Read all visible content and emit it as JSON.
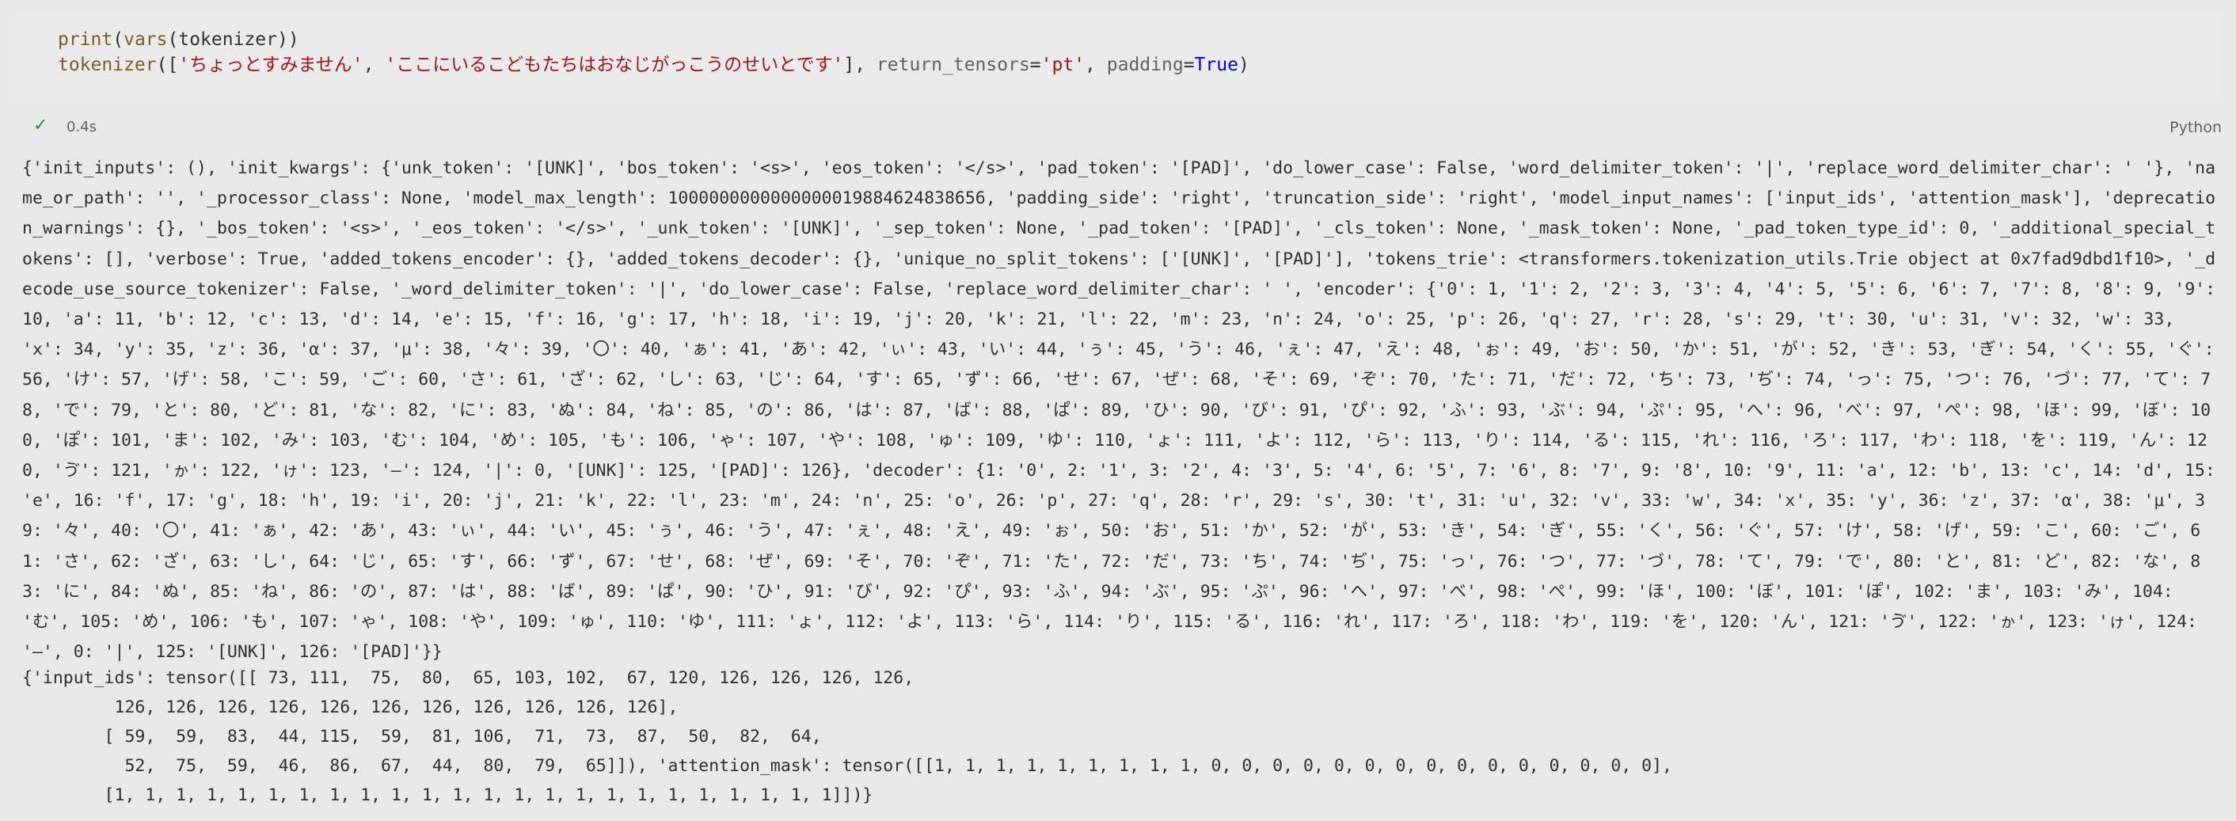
{
  "cell": {
    "code": {
      "line1": {
        "func": "print",
        "open": "(",
        "inner_func": "vars",
        "arg": "(tokenizer))"
      },
      "line2": {
        "func": "tokenizer",
        "open": "([",
        "str1": "'ちょっとすみません'",
        "comma": ", ",
        "str2": "'ここにいるこどもたちはおなじがっこうのせいとです'",
        "close": "], ",
        "param1": "return_tensors",
        "eq1": "=",
        "val1": "'pt'",
        "comma2": ", ",
        "param2": "padding",
        "eq2": "=",
        "val2": "True",
        "end": ")"
      }
    },
    "status": {
      "check_icon": "✓",
      "time": "0.4s",
      "language": "Python"
    },
    "output": {
      "vars_text": "{'init_inputs': (), 'init_kwargs': {'unk_token': '[UNK]', 'bos_token': '<s>', 'eos_token': '</s>', 'pad_token': '[PAD]', 'do_lower_case': False, 'word_delimiter_token': '|', 'replace_word_delimiter_char': ' '}, 'name_or_path': '', '_processor_class': None, 'model_max_length': 1000000000000000019884624838656, 'padding_side': 'right', 'truncation_side': 'right', 'model_input_names': ['input_ids', 'attention_mask'], 'deprecation_warnings': {}, '_bos_token': '<s>', '_eos_token': '</s>', '_unk_token': '[UNK]', '_sep_token': None, '_pad_token': '[PAD]', '_cls_token': None, '_mask_token': None, '_pad_token_type_id': 0, '_additional_special_tokens': [], 'verbose': True, 'added_tokens_encoder': {}, 'added_tokens_decoder': {}, 'unique_no_split_tokens': ['[UNK]', '[PAD]'], 'tokens_trie': <transformers.tokenization_utils.Trie object at 0x7fad9dbd1f10>, '_decode_use_source_tokenizer': False, '_word_delimiter_token': '|', 'do_lower_case': False, 'replace_word_delimiter_char': ' ', 'encoder': {'0': 1, '1': 2, '2': 3, '3': 4, '4': 5, '5': 6, '6': 7, '7': 8, '8': 9, '9': 10, 'a': 11, 'b': 12, 'c': 13, 'd': 14, 'e': 15, 'f': 16, 'g': 17, 'h': 18, 'i': 19, 'j': 20, 'k': 21, 'l': 22, 'm': 23, 'n': 24, 'o': 25, 'p': 26, 'q': 27, 'r': 28, 's': 29, 't': 30, 'u': 31, 'v': 32, 'w': 33, 'x': 34, 'y': 35, 'z': 36, 'α': 37, 'μ': 38, '々': 39, '〇': 40, 'ぁ': 41, 'あ': 42, 'ぃ': 43, 'い': 44, 'ぅ': 45, 'う': 46, 'ぇ': 47, 'え': 48, 'ぉ': 49, 'お': 50, 'か': 51, 'が': 52, 'き': 53, 'ぎ': 54, 'く': 55, 'ぐ': 56, 'け': 57, 'げ': 58, 'こ': 59, 'ご': 60, 'さ': 61, 'ざ': 62, 'し': 63, 'じ': 64, 'す': 65, 'ず': 66, 'せ': 67, 'ぜ': 68, 'そ': 69, 'ぞ': 70, 'た': 71, 'だ': 72, 'ち': 73, 'ぢ': 74, 'っ': 75, 'つ': 76, 'づ': 77, 'て': 78, 'で': 79, 'と': 80, 'ど': 81, 'な': 82, 'に': 83, 'ぬ': 84, 'ね': 85, 'の': 86, 'は': 87, 'ば': 88, 'ぱ': 89, 'ひ': 90, 'び': 91, 'ぴ': 92, 'ふ': 93, 'ぶ': 94, 'ぷ': 95, 'へ': 96, 'べ': 97, 'ぺ': 98, 'ほ': 99, 'ぼ': 100, 'ぽ': 101, 'ま': 102, 'み': 103, 'む': 104, 'め': 105, 'も': 106, 'ゃ': 107, 'や': 108, 'ゅ': 109, 'ゆ': 110, 'ょ': 111, 'よ': 112, 'ら': 113, 'り': 114, 'る': 115, 'れ': 116, 'ろ': 117, 'わ': 118, 'を': 119, 'ん': 120, 'ゔ': 121, 'ゕ': 122, 'ゖ': 123, '—': 124, '|': 0, '[UNK]': 125, '[PAD]': 126}, 'decoder': {1: '0', 2: '1', 3: '2', 4: '3', 5: '4', 6: '5', 7: '6', 8: '7', 9: '8', 10: '9', 11: 'a', 12: 'b', 13: 'c', 14: 'd', 15: 'e', 16: 'f', 17: 'g', 18: 'h', 19: 'i', 20: 'j', 21: 'k', 22: 'l', 23: 'm', 24: 'n', 25: 'o', 26: 'p', 27: 'q', 28: 'r', 29: 's', 30: 't', 31: 'u', 32: 'v', 33: 'w', 34: 'x', 35: 'y', 36: 'z', 37: 'α', 38: 'μ', 39: '々', 40: '〇', 41: 'ぁ', 42: 'あ', 43: 'ぃ', 44: 'い', 45: 'ぅ', 46: 'う', 47: 'ぇ', 48: 'え', 49: 'ぉ', 50: 'お', 51: 'か', 52: 'が', 53: 'き', 54: 'ぎ', 55: 'く', 56: 'ぐ', 57: 'け', 58: 'げ', 59: 'こ', 60: 'ご', 61: 'さ', 62: 'ざ', 63: 'し', 64: 'じ', 65: 'す', 66: 'ず', 67: 'せ', 68: 'ぜ', 69: 'そ', 70: 'ぞ', 71: 'た', 72: 'だ', 73: 'ち', 74: 'ぢ', 75: 'っ', 76: 'つ', 77: 'づ', 78: 'て', 79: 'で', 80: 'と', 81: 'ど', 82: 'な', 83: 'に', 84: 'ぬ', 85: 'ね', 86: 'の', 87: 'は', 88: 'ば', 89: 'ぱ', 90: 'ひ', 91: 'び', 92: 'ぴ', 93: 'ふ', 94: 'ぶ', 95: 'ぷ', 96: 'へ', 97: 'べ', 98: 'ぺ', 99: 'ほ', 100: 'ぼ', 101: 'ぽ', 102: 'ま', 103: 'み', 104: 'む', 105: 'め', 106: 'も', 107: 'ゃ', 108: 'や', 109: 'ゅ', 110: 'ゆ', 111: 'ょ', 112: 'よ', 113: 'ら', 114: 'り', 115: 'る', 116: 'れ', 117: 'ろ', 118: 'わ', 119: 'を', 120: 'ん', 121: 'ゔ', 122: 'ゕ', 123: 'ゖ', 124: '—', 0: '|', 125: '[UNK]', 126: '[PAD]'}}",
      "tensor_text": "{'input_ids': tensor([[ 73, 111,  75,  80,  65, 103, 102,  67, 120, 126, 126, 126, 126,\n         126, 126, 126, 126, 126, 126, 126, 126, 126, 126, 126],\n        [ 59,  59,  83,  44, 115,  59,  81, 106,  71,  73,  87,  50,  82,  64,\n          52,  75,  59,  46,  86,  67,  44,  80,  79,  65]]), 'attention_mask': tensor([[1, 1, 1, 1, 1, 1, 1, 1, 1, 0, 0, 0, 0, 0, 0, 0, 0, 0, 0, 0, 0, 0, 0, 0],\n        [1, 1, 1, 1, 1, 1, 1, 1, 1, 1, 1, 1, 1, 1, 1, 1, 1, 1, 1, 1, 1, 1, 1, 1]])}"
    }
  }
}
